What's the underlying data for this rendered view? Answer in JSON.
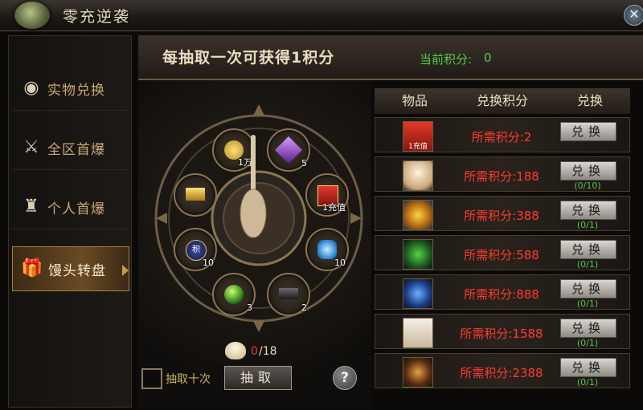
{
  "window": {
    "title": "零充逆袭",
    "close_symbol": "✕"
  },
  "sidebar": {
    "items": [
      {
        "label": "实物兑换",
        "icon": "egg-icon",
        "active": false
      },
      {
        "label": "全区首爆",
        "icon": "crossed-swords-icon",
        "active": false
      },
      {
        "label": "个人首爆",
        "icon": "warrior-icon",
        "active": false
      },
      {
        "label": "馒头转盘",
        "icon": "gift-icon",
        "active": true
      }
    ]
  },
  "banner": {
    "text": "每抽取一次可获得1积分",
    "points_label": "当前积分:",
    "points_value": "0"
  },
  "wheel": {
    "slots": [
      {
        "name": "gold-coins",
        "count": "1万"
      },
      {
        "name": "purple-gem",
        "count": "5"
      },
      {
        "name": "red-envelope",
        "count": "1充值"
      },
      {
        "name": "blue-crystal",
        "count": "10"
      },
      {
        "name": "iron-ingot",
        "count": "2"
      },
      {
        "name": "green-orb",
        "count": "3"
      },
      {
        "name": "points-token",
        "count": "10"
      },
      {
        "name": "gold-bar",
        "count": ""
      }
    ],
    "bun_current": "0",
    "bun_max": "/18",
    "draw_ten_label": "抽取十次",
    "draw_button": "抽取",
    "help_symbol": "?"
  },
  "table": {
    "headers": [
      "物品",
      "兑换积分",
      "兑换"
    ],
    "rows": [
      {
        "item": "red-envelope",
        "item_tag": "1充值",
        "required": "所需积分:2",
        "button": "兑换",
        "limit": ""
      },
      {
        "item": "steamed-bun",
        "item_tag": "",
        "required": "所需积分:188",
        "button": "兑换",
        "limit": "(0/10)"
      },
      {
        "item": "gold-ring",
        "item_tag": "",
        "required": "所需积分:388",
        "button": "兑换",
        "limit": "(0/1)"
      },
      {
        "item": "green-mount",
        "item_tag": "",
        "required": "所需积分:588",
        "button": "兑换",
        "limit": "(0/1)"
      },
      {
        "item": "blue-mount",
        "item_tag": "",
        "required": "所需积分:888",
        "button": "兑换",
        "limit": "(0/1)"
      },
      {
        "item": "white-horse",
        "item_tag": "",
        "required": "所需积分:1588",
        "button": "兑换",
        "limit": "(0/1)"
      },
      {
        "item": "demon-warrior",
        "item_tag": "",
        "required": "所需积分:2388",
        "button": "兑换",
        "limit": "(0/1)"
      }
    ]
  },
  "colors": {
    "points_green": "#55c94a",
    "cost_red": "#ff3b2f",
    "accent_gold": "#c79a4e"
  }
}
